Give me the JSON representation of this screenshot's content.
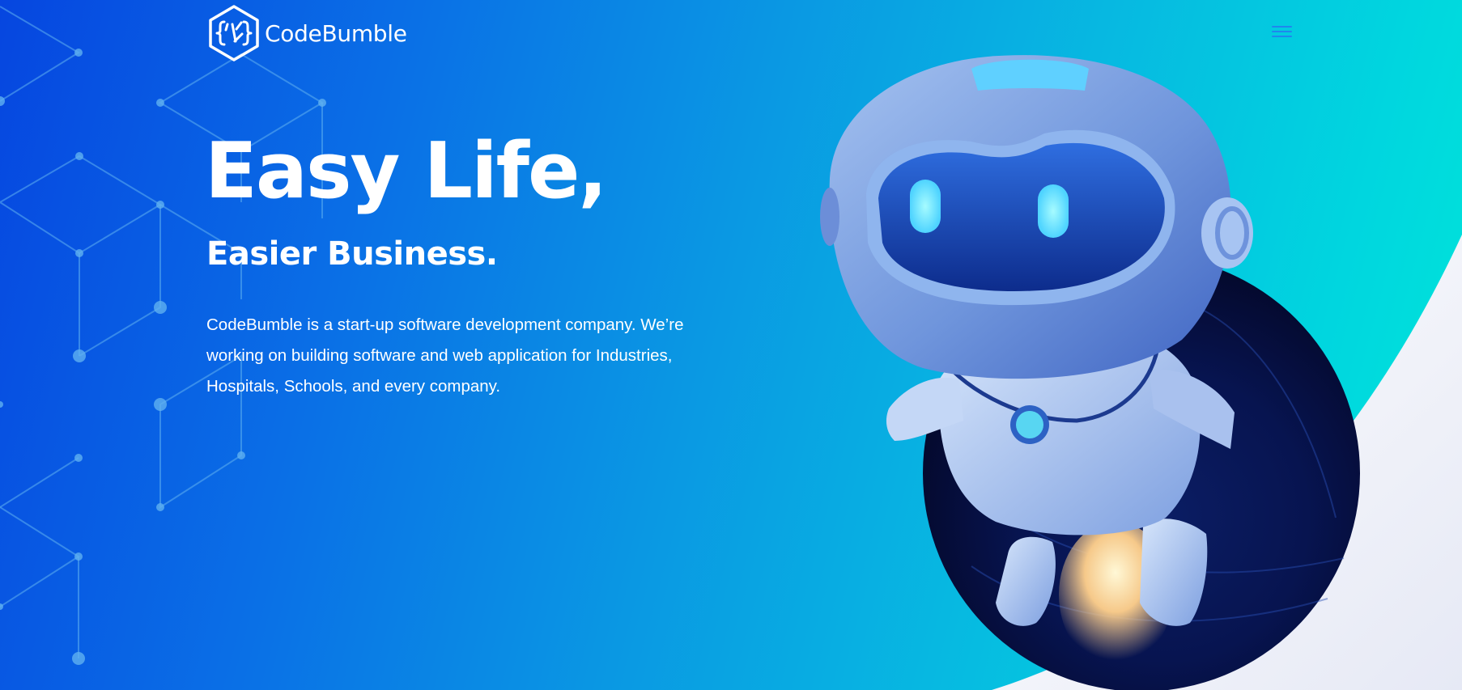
{
  "brand": {
    "name": "CodeBumble",
    "logo_icon": "curly-braces-hexagon-logo"
  },
  "nav": {
    "menu_icon": "hamburger-menu-icon",
    "menu_color": "#1f87ee"
  },
  "hero": {
    "headline": "Easy Life,",
    "subheadline": "Easier Business.",
    "description": "CodeBumble is a start-up software development company. We’re working on building software and web application for Industries, Hospitals, Schools, and every company.",
    "illustration": "robot-astronaut-with-jetpack-illustration"
  },
  "colors": {
    "gradient_start": "#0646e0",
    "gradient_end": "#00e8d8",
    "text": "#ffffff",
    "planet": "#0a1c5e",
    "robot_body": "#8fb3ea",
    "robot_eyes": "#7ff0ff"
  }
}
